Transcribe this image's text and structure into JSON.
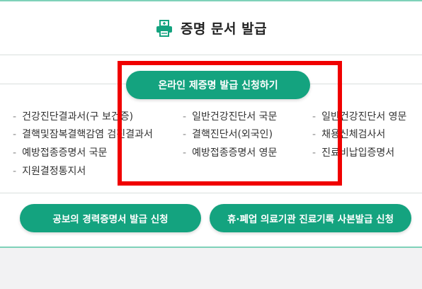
{
  "header": {
    "title": "증명 문서 발급",
    "icon": "printer-icon"
  },
  "online_button": {
    "label": "온라인 제증명 발급 신청하기"
  },
  "documents": [
    {
      "label": "건강진단결과서(구 보건증)"
    },
    {
      "label": "결핵및잠복결핵감염 검진결과서"
    },
    {
      "label": "예방접종증명서 국문"
    },
    {
      "label": "지원결정통지서"
    },
    {
      "label": "일반건강진단서 국문"
    },
    {
      "label": "결핵진단서(외국인)"
    },
    {
      "label": "예방접종증명서 영문"
    },
    {
      "label": "일반건강진단서 영문"
    },
    {
      "label": "채용신체검사서"
    },
    {
      "label": "진료비납입증명서"
    }
  ],
  "bottom_buttons": [
    {
      "label": "공보의 경력증명서 발급 신청"
    },
    {
      "label": "휴·폐업 의료기관 진료기록 사본발급 신청"
    }
  ],
  "colors": {
    "accent": "#14a37f",
    "border": "#7fd1b9",
    "highlight": "#f00000"
  }
}
